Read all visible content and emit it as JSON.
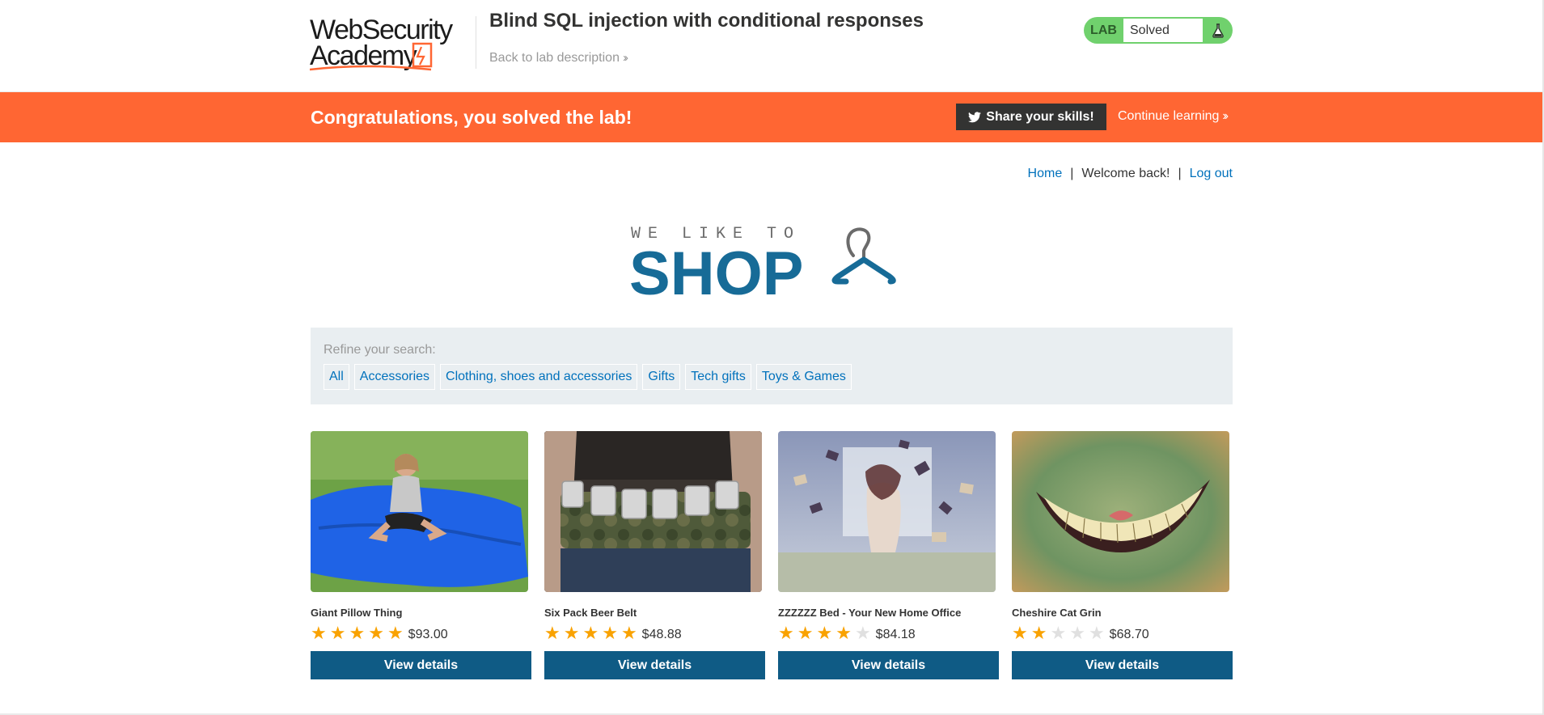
{
  "academy": {
    "logo_line1": "WebSecurity",
    "logo_line2": "Academy",
    "lab_title": "Blind SQL injection with conditional responses",
    "back_link": "Back to lab description",
    "lab_label": "LAB",
    "lab_state": "Solved"
  },
  "notification": {
    "congrats": "Congratulations, you solved the lab!",
    "share_button": "Share your skills!",
    "continue_link": "Continue learning"
  },
  "nav": {
    "home": "Home",
    "separator": "|",
    "welcome": "Welcome back!",
    "logout": "Log out"
  },
  "hero": {
    "tagline": "WE LIKE TO",
    "word": "SHOP"
  },
  "filters": {
    "label": "Refine your search:",
    "categories": [
      "All",
      "Accessories",
      "Clothing, shoes and accessories",
      "Gifts",
      "Tech gifts",
      "Toys & Games"
    ]
  },
  "products": [
    {
      "name": "Giant Pillow Thing",
      "rating": 5,
      "price": "$93.00",
      "button": "View details"
    },
    {
      "name": "Six Pack Beer Belt",
      "rating": 5,
      "price": "$48.88",
      "button": "View details"
    },
    {
      "name": "ZZZZZZ Bed - Your New Home Office",
      "rating": 4,
      "price": "$84.18",
      "button": "View details"
    },
    {
      "name": "Cheshire Cat Grin",
      "rating": 2,
      "price": "$68.70",
      "button": "View details"
    }
  ],
  "colors": {
    "brand_orange": "#ff6633",
    "link_blue": "#0071bc",
    "button_blue": "#0f5b85",
    "lab_green": "#70d16d",
    "star": "#f9a200"
  }
}
